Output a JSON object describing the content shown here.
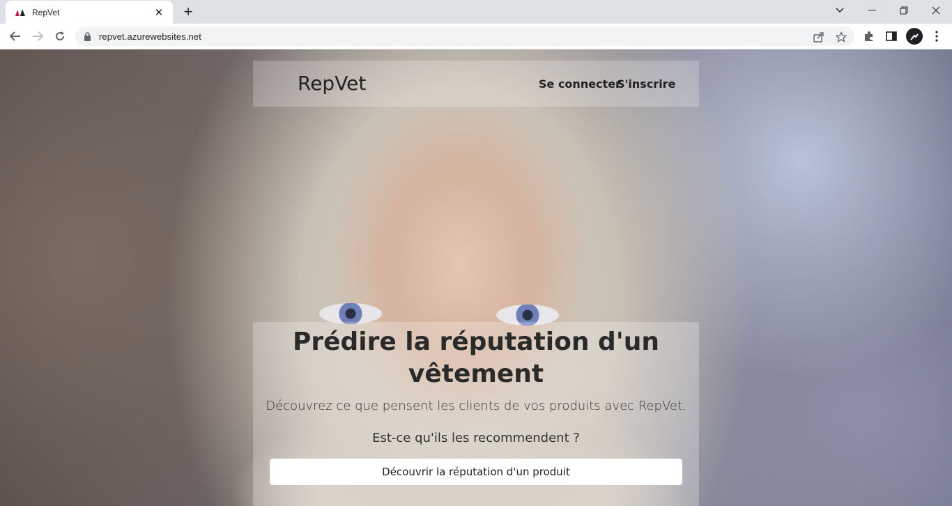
{
  "browser": {
    "tab_title": "RepVet",
    "url": "repvet.azurewebsites.net",
    "accent": "#dee1e6"
  },
  "icons": [
    "favicon-icon",
    "close-icon",
    "plus-icon",
    "chevron-down-icon",
    "minimize-icon",
    "restore-icon",
    "close-window-icon",
    "back-icon",
    "forward-icon",
    "reload-icon",
    "lock-icon",
    "share-icon",
    "star-icon",
    "puzzle-icon",
    "side-panel-icon",
    "avatar",
    "kebab-menu-icon"
  ],
  "site": {
    "brand": "RepVet",
    "nav": {
      "login": "Se connecter",
      "signup": "S'inscrire"
    },
    "hero": {
      "title": "Prédire la réputation d'un vêtement",
      "subtitle": "Découvrez ce que pensent les clients de vos produits avec RepVet.",
      "question": "Est-ce qu'ils les recommendent ?",
      "cta": "Découvrir la réputation d'un produit"
    }
  }
}
